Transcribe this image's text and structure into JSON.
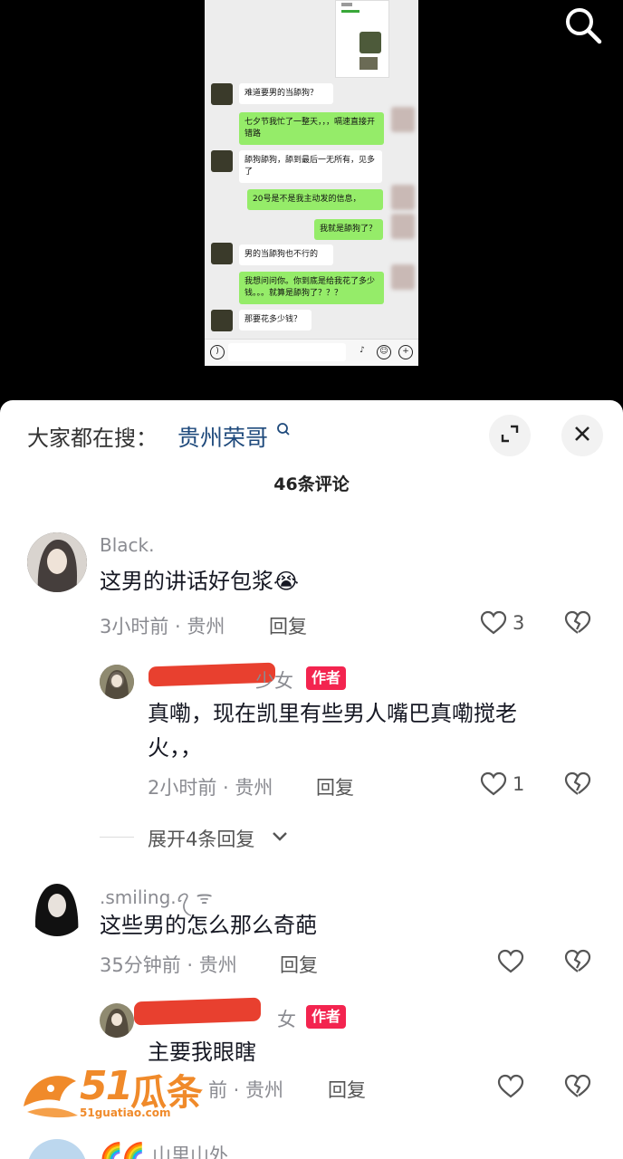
{
  "video": {
    "search_icon": "search-icon",
    "chat": [
      {
        "side": "in",
        "text": "难道要男的当舔狗？"
      },
      {
        "side": "out",
        "text": "七夕节我忙了一整天，，，嗝速直接开错路"
      },
      {
        "side": "in",
        "text": "舔狗舔狗，舔到最后一无所有，见多了"
      },
      {
        "side": "out",
        "text": "20号是不是我主动发的信息，"
      },
      {
        "side": "out",
        "text": "我就是舔狗了？"
      },
      {
        "side": "in",
        "text": "男的当舔狗也不行的"
      },
      {
        "side": "out",
        "text": "我想问问你。你到底是给我花了多少钱。。。就算是舔狗了？？？"
      },
      {
        "side": "in",
        "text": "那要花多少钱？"
      }
    ]
  },
  "sheet": {
    "search_hint": "大家都在搜：",
    "search_term": "贵州荣哥",
    "comment_count": "46条评论",
    "comments": [
      {
        "name": "Black.",
        "text": "这男的讲话好包浆😭",
        "time": "3小时前 · 贵州",
        "reply": "回复",
        "likes": "3"
      },
      {
        "name_suffix": "少女",
        "tag": "作者",
        "text_line1": "真嘞，现在凯里有些男人嘴巴真嘞搅老",
        "text_line2": "火，，",
        "time": "2小时前 · 贵州",
        "reply": "回复",
        "likes": "1",
        "expand": "展开4条回复"
      },
      {
        "name": ".smiling.ꪖ ᯤ",
        "text": "这些男的怎么那么奇葩",
        "time": "35分钟前 · 贵州",
        "reply": "回复"
      },
      {
        "name_suffix": "女",
        "tag": "作者",
        "text": "主要我眼瞎",
        "time": "前 · 贵州",
        "reply": "回复"
      },
      {
        "name": "山里山外"
      }
    ]
  },
  "watermark": {
    "brand": "51",
    "url": "51guatiao.com"
  }
}
